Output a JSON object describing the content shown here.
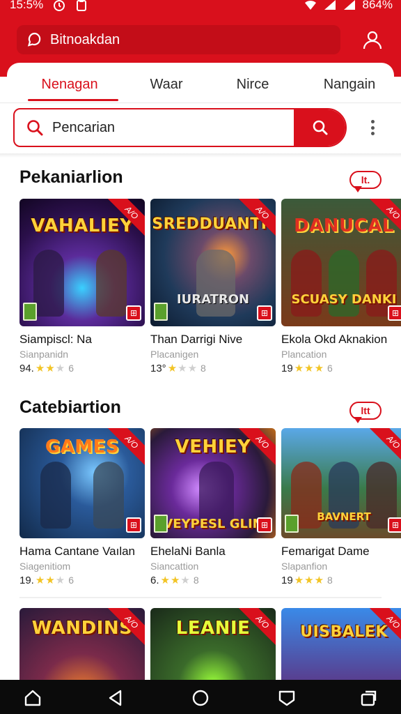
{
  "status_bar": {
    "time": "15:5%",
    "battery": "864%"
  },
  "app_bar": {
    "brand_label": "Bitnoakdan"
  },
  "tabs": [
    {
      "label": "Nenagan",
      "active": true
    },
    {
      "label": "Waar",
      "active": false
    },
    {
      "label": "Nirce",
      "active": false
    },
    {
      "label": "Nangain",
      "active": false
    }
  ],
  "search": {
    "placeholder": "Pencarian"
  },
  "sections": [
    {
      "title": "Pekaniarlion",
      "badge": "lt.",
      "cards": [
        {
          "art_title": "VAHALIEY",
          "art_sub": "",
          "title": "Siampiscl: Na",
          "subtitle": "Sianpanidn",
          "score": "94.",
          "stars_on": 2,
          "count": "6"
        },
        {
          "art_title": "SREDDUANTH",
          "art_sub": "IURATRON",
          "title": "Than Darrigi Nive",
          "subtitle": "Placanigen",
          "score": "13°",
          "stars_on": 1,
          "count": "8"
        },
        {
          "art_title": "DANUCAL",
          "art_sub": "SCUASY DANKI",
          "title": "Ekola Okd Aknakion",
          "subtitle": "Plancation",
          "score": "19",
          "stars_on": 3,
          "count": "6"
        }
      ]
    },
    {
      "title": "Catebiartion",
      "badge": "ltt",
      "cards": [
        {
          "art_title": "GAMES",
          "art_sub": "",
          "title": "Hama Cantane Vaılan",
          "subtitle": "Siagenitiom",
          "score": "19.",
          "stars_on": 2,
          "count": "6"
        },
        {
          "art_title": "VEHIEY",
          "art_sub": "VEYPESL GLIN",
          "title": "EhelaNi Banla",
          "subtitle": "Siancattion",
          "score": "6.",
          "stars_on": 2,
          "count": "8"
        },
        {
          "art_title": "BAVNERT",
          "art_sub": "",
          "title": "Femarigat Dame",
          "subtitle": "Slapanfion",
          "score": "19",
          "stars_on": 3,
          "count": "8"
        }
      ]
    },
    {
      "cards": [
        {
          "art_title": "WANDINS"
        },
        {
          "art_title": "LEANIE"
        },
        {
          "art_title": "UISBALEK"
        }
      ]
    }
  ],
  "ribbon_label": "A/O",
  "colors": {
    "accent": "#d9101c",
    "star": "#f2c425"
  }
}
